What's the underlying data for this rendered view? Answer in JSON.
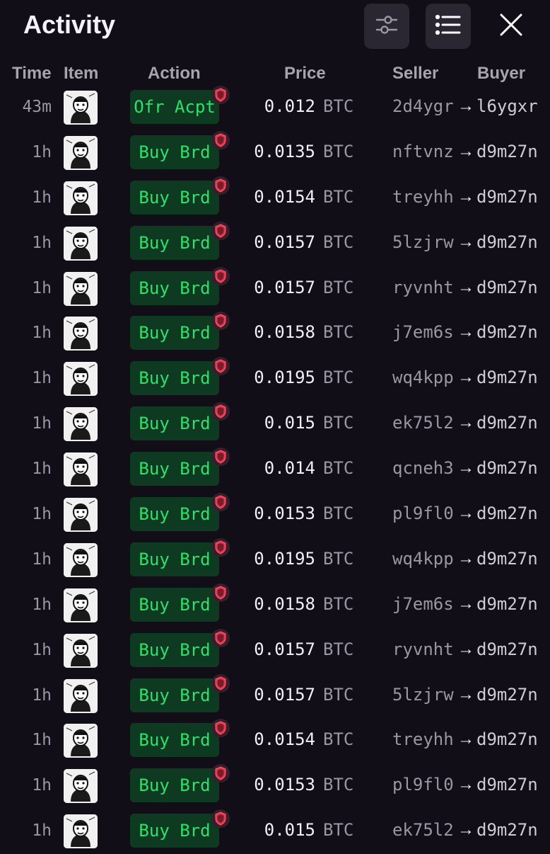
{
  "header": {
    "title": "Activity",
    "filter_icon": "sliders-icon",
    "list_icon": "list-icon",
    "close_icon": "close-icon"
  },
  "columns": {
    "time": "Time",
    "item": "Item",
    "action": "Action",
    "price": "Price",
    "seller": "Seller",
    "buyer": "Buyer"
  },
  "colors": {
    "background": "#120e18",
    "action_bg": "#0f3a22",
    "action_text": "#2fe06a",
    "badge_shield": "#e0394f"
  },
  "rows": [
    {
      "time": "43m",
      "action": "Ofr Acpt",
      "price": "0.012",
      "unit": "BTC",
      "seller": "2d4ygr",
      "arrow": "→",
      "buyer": "l6ygxr"
    },
    {
      "time": "1h",
      "action": "Buy Brd",
      "price": "0.0135",
      "unit": "BTC",
      "seller": "nftvnz",
      "arrow": "→",
      "buyer": "d9m27n"
    },
    {
      "time": "1h",
      "action": "Buy Brd",
      "price": "0.0154",
      "unit": "BTC",
      "seller": "treyhh",
      "arrow": "→",
      "buyer": "d9m27n"
    },
    {
      "time": "1h",
      "action": "Buy Brd",
      "price": "0.0157",
      "unit": "BTC",
      "seller": "5lzjrw",
      "arrow": "→",
      "buyer": "d9m27n"
    },
    {
      "time": "1h",
      "action": "Buy Brd",
      "price": "0.0157",
      "unit": "BTC",
      "seller": "ryvnht",
      "arrow": "→",
      "buyer": "d9m27n"
    },
    {
      "time": "1h",
      "action": "Buy Brd",
      "price": "0.0158",
      "unit": "BTC",
      "seller": "j7em6s",
      "arrow": "→",
      "buyer": "d9m27n"
    },
    {
      "time": "1h",
      "action": "Buy Brd",
      "price": "0.0195",
      "unit": "BTC",
      "seller": "wq4kpp",
      "arrow": "→",
      "buyer": "d9m27n"
    },
    {
      "time": "1h",
      "action": "Buy Brd",
      "price": "0.015",
      "unit": "BTC",
      "seller": "ek75l2",
      "arrow": "→",
      "buyer": "d9m27n"
    },
    {
      "time": "1h",
      "action": "Buy Brd",
      "price": "0.014",
      "unit": "BTC",
      "seller": "qcneh3",
      "arrow": "→",
      "buyer": "d9m27n"
    },
    {
      "time": "1h",
      "action": "Buy Brd",
      "price": "0.0153",
      "unit": "BTC",
      "seller": "pl9fl0",
      "arrow": "→",
      "buyer": "d9m27n"
    },
    {
      "time": "1h",
      "action": "Buy Brd",
      "price": "0.0195",
      "unit": "BTC",
      "seller": "wq4kpp",
      "arrow": "→",
      "buyer": "d9m27n"
    },
    {
      "time": "1h",
      "action": "Buy Brd",
      "price": "0.0158",
      "unit": "BTC",
      "seller": "j7em6s",
      "arrow": "→",
      "buyer": "d9m27n"
    },
    {
      "time": "1h",
      "action": "Buy Brd",
      "price": "0.0157",
      "unit": "BTC",
      "seller": "ryvnht",
      "arrow": "→",
      "buyer": "d9m27n"
    },
    {
      "time": "1h",
      "action": "Buy Brd",
      "price": "0.0157",
      "unit": "BTC",
      "seller": "5lzjrw",
      "arrow": "→",
      "buyer": "d9m27n"
    },
    {
      "time": "1h",
      "action": "Buy Brd",
      "price": "0.0154",
      "unit": "BTC",
      "seller": "treyhh",
      "arrow": "→",
      "buyer": "d9m27n"
    },
    {
      "time": "1h",
      "action": "Buy Brd",
      "price": "0.0153",
      "unit": "BTC",
      "seller": "pl9fl0",
      "arrow": "→",
      "buyer": "d9m27n"
    },
    {
      "time": "1h",
      "action": "Buy Brd",
      "price": "0.015",
      "unit": "BTC",
      "seller": "ek75l2",
      "arrow": "→",
      "buyer": "d9m27n"
    }
  ]
}
